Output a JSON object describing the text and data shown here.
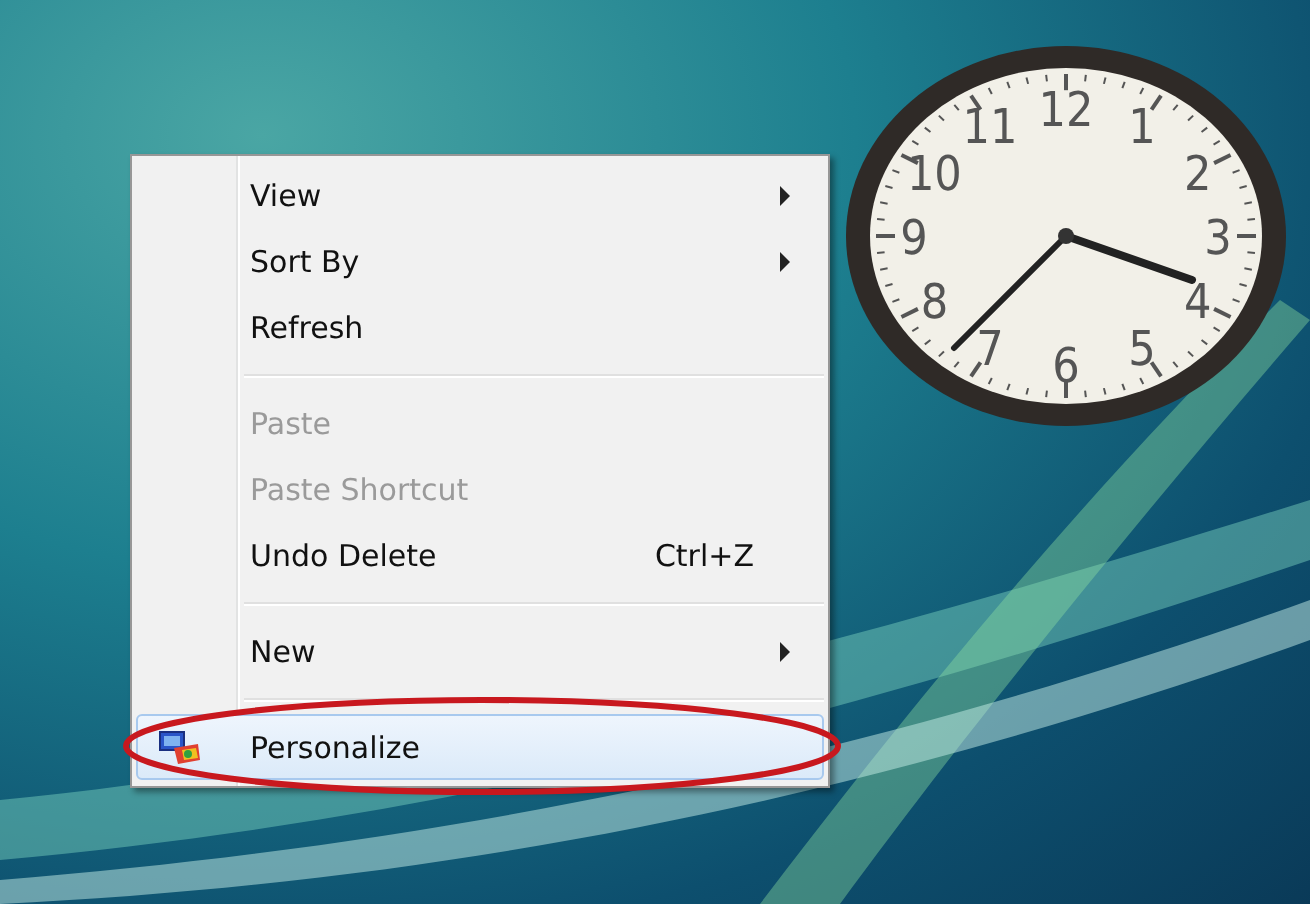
{
  "context_menu": {
    "items": [
      {
        "kind": "item",
        "label": "View",
        "submenu": true,
        "disabled": false,
        "selected": false
      },
      {
        "kind": "item",
        "label": "Sort By",
        "submenu": true,
        "disabled": false,
        "selected": false
      },
      {
        "kind": "item",
        "label": "Refresh",
        "submenu": false,
        "disabled": false,
        "selected": false
      },
      {
        "kind": "separator"
      },
      {
        "kind": "item",
        "label": "Paste",
        "submenu": false,
        "disabled": true,
        "selected": false
      },
      {
        "kind": "item",
        "label": "Paste Shortcut",
        "submenu": false,
        "disabled": true,
        "selected": false
      },
      {
        "kind": "item",
        "label": "Undo Delete",
        "shortcut": "Ctrl+Z",
        "submenu": false,
        "disabled": false,
        "selected": false
      },
      {
        "kind": "separator"
      },
      {
        "kind": "item",
        "label": "New",
        "submenu": true,
        "disabled": false,
        "selected": false
      },
      {
        "kind": "separator"
      },
      {
        "kind": "item",
        "label": "Personalize",
        "icon": true,
        "submenu": false,
        "disabled": false,
        "selected": true,
        "circled": true
      }
    ]
  },
  "clock_gadget": {
    "numerals": [
      "12",
      "11",
      "1",
      "10",
      "2",
      "9",
      "3",
      "8",
      "4",
      "7",
      "5",
      "6"
    ]
  }
}
